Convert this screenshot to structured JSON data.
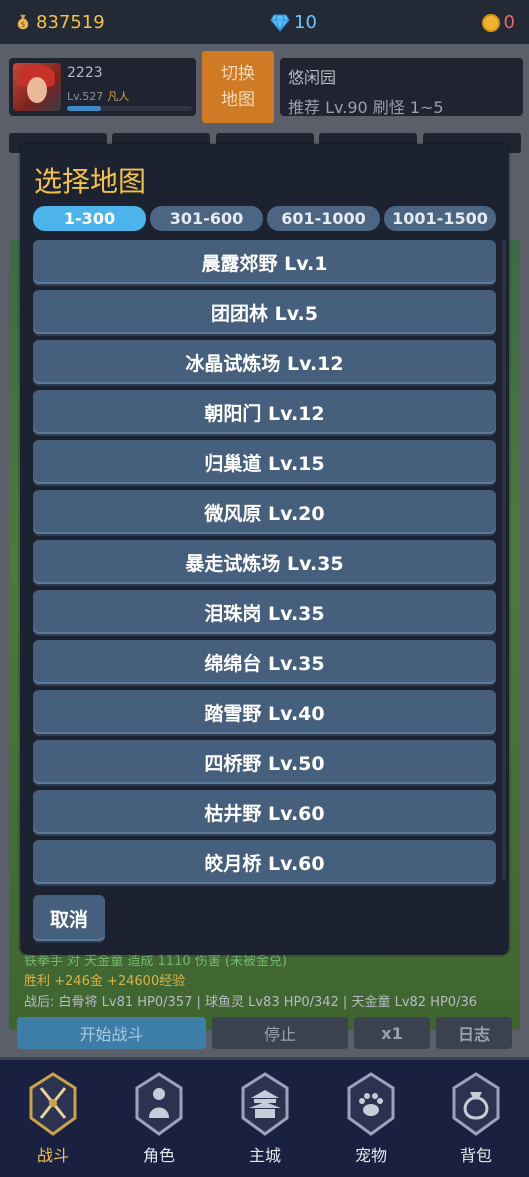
{
  "resources": {
    "gold": "837519",
    "gems": "10",
    "coins": "0"
  },
  "player": {
    "name": "2223",
    "level": "Lv.527",
    "rank": "凡人",
    "xp_progress": 0.27
  },
  "switch_map": {
    "line1": "切换",
    "line2": "地图"
  },
  "current_map": {
    "name": "悠闲园",
    "info": "推荐 Lv.90  刷怪 1~5"
  },
  "modal": {
    "title": "选择地图",
    "tabs": [
      {
        "label": "1-300",
        "active": true
      },
      {
        "label": "301-600",
        "active": false
      },
      {
        "label": "601-1000",
        "active": false
      },
      {
        "label": "1001-1500",
        "active": false
      }
    ],
    "maps": [
      "晨露郊野  Lv.1",
      "团团林  Lv.5",
      "冰晶试炼场  Lv.12",
      "朝阳门  Lv.12",
      "归巢道  Lv.15",
      "微风原  Lv.20",
      "暴走试炼场  Lv.35",
      "泪珠岗  Lv.35",
      "绵绵台  Lv.35",
      "踏雪野  Lv.40",
      "四桥野  Lv.50",
      "枯井野  Lv.60",
      "皎月桥  Lv.60"
    ],
    "cancel": "取消"
  },
  "battle_log": [
    "铁拳手 对 天金童 造成 1110 伤害 (未被金兑)",
    "胜利 +246金 +24600经验",
    "战后: 白骨将 Lv81 HP0/357 | 球鱼灵 Lv83 HP0/342 | 天金童 Lv82 HP0/36"
  ],
  "controls": {
    "start": "开始战斗",
    "stop": "停止",
    "speed": "x1",
    "log": "日志"
  },
  "nav": [
    {
      "label": "战斗",
      "icon": "crossed-swords-icon",
      "active": true
    },
    {
      "label": "角色",
      "icon": "character-icon",
      "active": false
    },
    {
      "label": "主城",
      "icon": "castle-icon",
      "active": false
    },
    {
      "label": "宠物",
      "icon": "paw-icon",
      "active": false
    },
    {
      "label": "背包",
      "icon": "bag-icon",
      "active": false
    }
  ],
  "colors": {
    "accent": "#f2c14a",
    "tab_active": "#4cb4ea",
    "button": "#465f7d",
    "modal_bg": "#1d2230"
  }
}
